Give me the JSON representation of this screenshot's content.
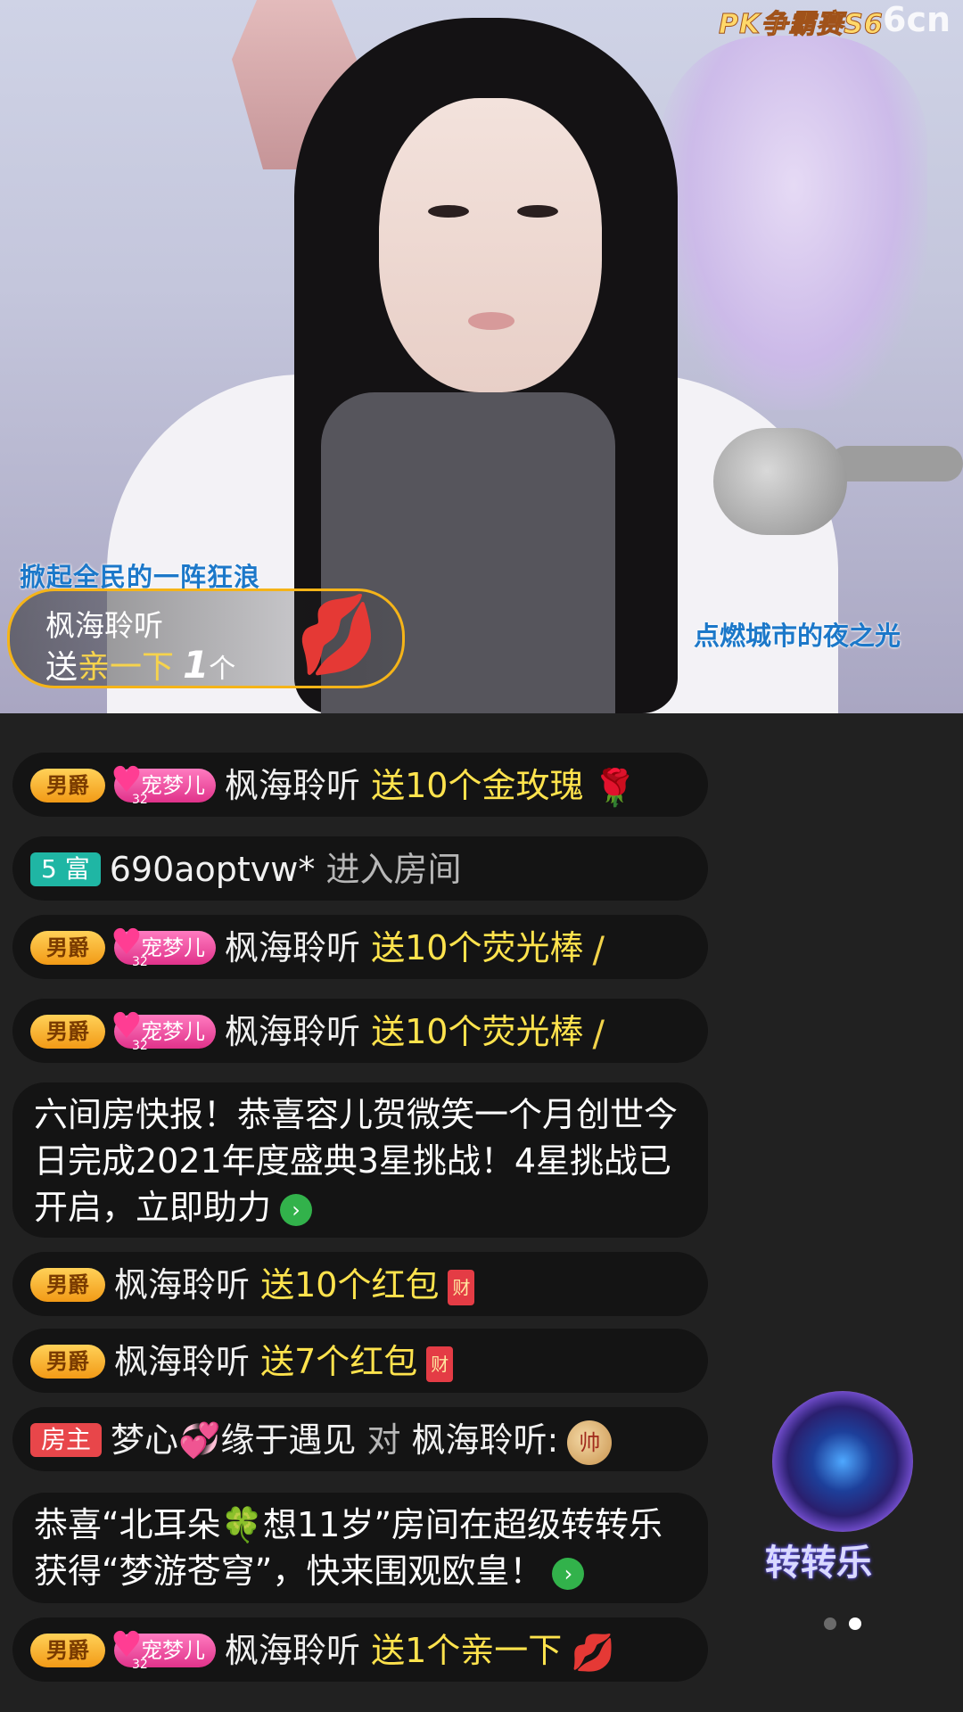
{
  "stream": {
    "event_logo": "PK争霸赛S6",
    "site_logo": "6cn",
    "banner_left": "掀起全民的一阵狂浪",
    "banner_right": "点燃城市的夜之光"
  },
  "gift_notice": {
    "sender": "枫海聆听",
    "verb": "送",
    "item": "亲一下",
    "count": "1",
    "unit": "个",
    "icon": "kiss-lips-icon"
  },
  "chat": {
    "badges": {
      "noble": "男爵",
      "fan_club": "宠梦儿",
      "fan_level": "32",
      "rich_level": "5 富",
      "host": "房主"
    },
    "messages": [
      {
        "user": "枫海聆听",
        "action": "送10个金玫瑰",
        "icon": "gold-rose-icon"
      },
      {
        "user": "690aoptvw*",
        "action": "进入房间"
      },
      {
        "user": "枫海聆听",
        "action": "送10个荧光棒",
        "icon": "glow-stick-icon"
      },
      {
        "user": "枫海聆听",
        "action": "送10个荧光棒",
        "icon": "glow-stick-icon"
      },
      {
        "text": " 六间房快报！恭喜容儿贺微笑一个月创世今日完成2021年度盛典3星挑战！4星挑战已开启，立即助力",
        "icon": "arrow-right-icon"
      },
      {
        "user": "枫海聆听",
        "action": "送10个红包",
        "icon": "red-envelope-icon",
        "icon_text": "财"
      },
      {
        "user": "枫海聆听",
        "action": "送7个红包",
        "icon": "red-envelope-icon",
        "icon_text": "财"
      },
      {
        "user": "梦心💞缘于遇见",
        "to_word": "对",
        "target": "枫海聆听:",
        "icon": "chess-piece-icon",
        "icon_text": "帅"
      },
      {
        "text": "恭喜“北耳朵🍀想11岁”房间在超级转转乐获得“梦游苍穹”，快来围观欧皇！",
        "icon": "arrow-right-icon"
      },
      {
        "user": "枫海聆听",
        "action": "送1个亲一下",
        "icon": "kiss-lips-icon"
      }
    ]
  },
  "widget": {
    "label": "转转乐",
    "icon": "lucky-wheel-icon",
    "pages": 2,
    "active_page": 2
  }
}
